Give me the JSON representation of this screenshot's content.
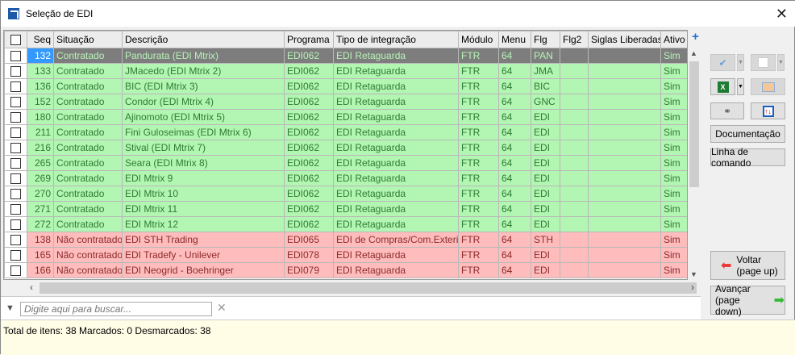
{
  "window": {
    "title": "Seleção de EDI",
    "close": "✕"
  },
  "grid": {
    "columns": [
      "Seq",
      "Situação",
      "Descrição",
      "Programa",
      "Tipo de integração",
      "Módulo",
      "Menu",
      "Flg",
      "Flg2",
      "Siglas Liberadas",
      "Ativo"
    ],
    "rows": [
      {
        "seq": "132",
        "situacao": "Contratado",
        "descricao": "Pandurata (EDI Mtrix)",
        "programa": "EDI062",
        "tipo": "EDI Retaguarda",
        "modulo": "FTR",
        "menu": "64",
        "flg": "PAN",
        "flg2": "",
        "siglas": "",
        "ativo": "Sim",
        "status": "sel"
      },
      {
        "seq": "133",
        "situacao": "Contratado",
        "descricao": "JMacedo (EDI Mtrix 2)",
        "programa": "EDI062",
        "tipo": "EDI Retaguarda",
        "modulo": "FTR",
        "menu": "64",
        "flg": "JMA",
        "flg2": "",
        "siglas": "",
        "ativo": "Sim",
        "status": "ok"
      },
      {
        "seq": "136",
        "situacao": "Contratado",
        "descricao": "BIC (EDI Mtrix 3)",
        "programa": "EDI062",
        "tipo": "EDI Retaguarda",
        "modulo": "FTR",
        "menu": "64",
        "flg": "BIC",
        "flg2": "",
        "siglas": "",
        "ativo": "Sim",
        "status": "ok"
      },
      {
        "seq": "152",
        "situacao": "Contratado",
        "descricao": "Condor (EDI Mtrix 4)",
        "programa": "EDI062",
        "tipo": "EDI Retaguarda",
        "modulo": "FTR",
        "menu": "64",
        "flg": "GNC",
        "flg2": "",
        "siglas": "",
        "ativo": "Sim",
        "status": "ok"
      },
      {
        "seq": "180",
        "situacao": "Contratado",
        "descricao": "Ajinomoto (EDI Mtrix 5)",
        "programa": "EDI062",
        "tipo": "EDI Retaguarda",
        "modulo": "FTR",
        "menu": "64",
        "flg": "EDI",
        "flg2": "",
        "siglas": "",
        "ativo": "Sim",
        "status": "ok"
      },
      {
        "seq": "211",
        "situacao": "Contratado",
        "descricao": "Fini Guloseimas (EDI Mtrix 6)",
        "programa": "EDI062",
        "tipo": "EDI Retaguarda",
        "modulo": "FTR",
        "menu": "64",
        "flg": "EDI",
        "flg2": "",
        "siglas": "",
        "ativo": "Sim",
        "status": "ok"
      },
      {
        "seq": "216",
        "situacao": "Contratado",
        "descricao": "Stival (EDI Mtrix 7)",
        "programa": "EDI062",
        "tipo": "EDI Retaguarda",
        "modulo": "FTR",
        "menu": "64",
        "flg": "EDI",
        "flg2": "",
        "siglas": "",
        "ativo": "Sim",
        "status": "ok"
      },
      {
        "seq": "265",
        "situacao": "Contratado",
        "descricao": "Seara (EDI Mtrix 8)",
        "programa": "EDI062",
        "tipo": "EDI Retaguarda",
        "modulo": "FTR",
        "menu": "64",
        "flg": "EDI",
        "flg2": "",
        "siglas": "",
        "ativo": "Sim",
        "status": "ok"
      },
      {
        "seq": "269",
        "situacao": "Contratado",
        "descricao": "EDI Mtrix 9",
        "programa": "EDI062",
        "tipo": "EDI Retaguarda",
        "modulo": "FTR",
        "menu": "64",
        "flg": "EDI",
        "flg2": "",
        "siglas": "",
        "ativo": "Sim",
        "status": "ok"
      },
      {
        "seq": "270",
        "situacao": "Contratado",
        "descricao": "EDI Mtrix 10",
        "programa": "EDI062",
        "tipo": "EDI Retaguarda",
        "modulo": "FTR",
        "menu": "64",
        "flg": "EDI",
        "flg2": "",
        "siglas": "",
        "ativo": "Sim",
        "status": "ok"
      },
      {
        "seq": "271",
        "situacao": "Contratado",
        "descricao": "EDI Mtrix 11",
        "programa": "EDI062",
        "tipo": "EDI Retaguarda",
        "modulo": "FTR",
        "menu": "64",
        "flg": "EDI",
        "flg2": "",
        "siglas": "",
        "ativo": "Sim",
        "status": "ok"
      },
      {
        "seq": "272",
        "situacao": "Contratado",
        "descricao": "EDI Mtrix 12",
        "programa": "EDI062",
        "tipo": "EDI Retaguarda",
        "modulo": "FTR",
        "menu": "64",
        "flg": "EDI",
        "flg2": "",
        "siglas": "",
        "ativo": "Sim",
        "status": "ok"
      },
      {
        "seq": "138",
        "situacao": "Não contratado",
        "descricao": "EDI STH Trading",
        "programa": "EDI065",
        "tipo": "EDI de Compras/Com.Exterior",
        "modulo": "FTR",
        "menu": "64",
        "flg": "STH",
        "flg2": "",
        "siglas": "",
        "ativo": "Sim",
        "status": "no"
      },
      {
        "seq": "165",
        "situacao": "Não contratado",
        "descricao": "EDI Tradefy - Unilever",
        "programa": "EDI078",
        "tipo": "EDI Retaguarda",
        "modulo": "FTR",
        "menu": "64",
        "flg": "EDI",
        "flg2": "",
        "siglas": "",
        "ativo": "Sim",
        "status": "no"
      },
      {
        "seq": "166",
        "situacao": "Não contratado",
        "descricao": "EDI Neogrid - Boehringer",
        "programa": "EDI079",
        "tipo": "EDI Retaguarda",
        "modulo": "FTR",
        "menu": "64",
        "flg": "EDI",
        "flg2": "",
        "siglas": "",
        "ativo": "Sim",
        "status": "no"
      }
    ]
  },
  "search": {
    "placeholder": "Digite aqui para buscar..."
  },
  "status": {
    "text": "Total de itens: 38 Marcados: 0 Desmarcados: 38"
  },
  "side": {
    "documentacao": "Documentação",
    "linha": "Linha de comando",
    "voltar": "Voltar",
    "voltar_sub": "(page up)",
    "avancar": "Avançar",
    "avancar_sub": "(page down)"
  }
}
